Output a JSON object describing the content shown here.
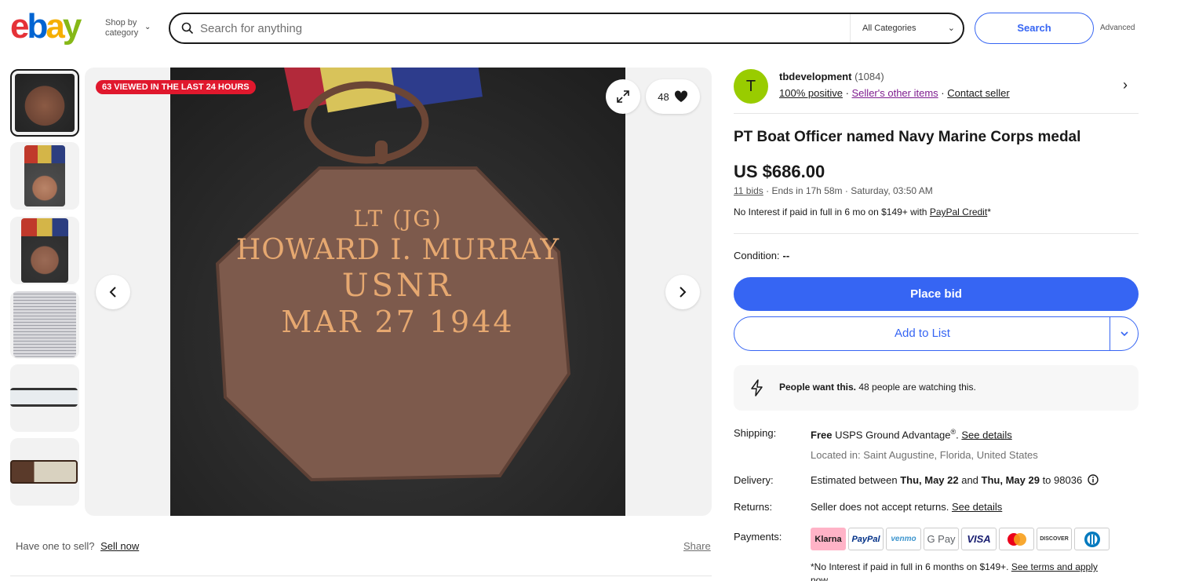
{
  "header": {
    "logo_letters": [
      "e",
      "b",
      "a",
      "y"
    ],
    "shop_by_line1": "Shop by",
    "shop_by_line2": "category",
    "search_placeholder": "Search for anything",
    "category_select": "All Categories",
    "search_button": "Search",
    "advanced": "Advanced"
  },
  "gallery": {
    "viewed_badge": "63 VIEWED IN THE LAST 24 HOURS",
    "watch_count": "48",
    "medal_engraving": [
      "LT (JG)",
      "HOWARD I. MURRAY",
      "USNR",
      "MAR 27 1944"
    ]
  },
  "below_gallery": {
    "sell_prompt": "Have one to sell?",
    "sell_link": "Sell now",
    "share": "Share"
  },
  "seller": {
    "avatar_letter": "T",
    "name": "tbdevelopment",
    "feedback_count": "(1084)",
    "positive": "100% positive",
    "other_items": "Seller's other items",
    "contact": "Contact seller"
  },
  "item": {
    "title": "PT Boat Officer named Navy Marine Corps medal",
    "price": "US $686.00",
    "bids": "11 bids",
    "ends": " · Ends in 17h 58m · Saturday, 03:50 AM",
    "credit_text": "No Interest if paid in full in 6 mo on $149+ with ",
    "credit_link": "PayPal Credit",
    "credit_suffix": "*",
    "condition_label": "Condition:",
    "condition_value": "--",
    "place_bid": "Place bid",
    "add_to_list": "Add to List",
    "people_bold": "People want this.",
    "people_rest": " 48 people are watching this."
  },
  "details": {
    "shipping_label": "Shipping:",
    "shipping_free": "Free",
    "shipping_service": " USPS Ground Advantage",
    "shipping_reg": "®",
    "shipping_dot": ". ",
    "see_details": "See details",
    "located": "Located in: Saint Augustine, Florida, United States",
    "delivery_label": "Delivery:",
    "delivery_prefix": "Estimated between ",
    "delivery_start": "Thu, May 22",
    "delivery_and": " and ",
    "delivery_end": "Thu, May 29",
    "delivery_zip": " to 98036",
    "returns_label": "Returns:",
    "returns_text": "Seller does not accept returns. ",
    "returns_link": "See details",
    "payments_label": "Payments:",
    "payment_methods": [
      "Klarna",
      "PayPal",
      "venmo",
      "G Pay",
      "VISA",
      "",
      "DISCOVER",
      ""
    ],
    "payments_note": "*No Interest if paid in full in 6 months on $149+. ",
    "payments_note_link": "See terms and apply",
    "payments_note_tail": "now"
  },
  "colors": {
    "accent": "#3665f3",
    "badge_red": "#e0182d",
    "avatar_green": "#99cc00",
    "klarna_pink": "#ffb3c7"
  }
}
